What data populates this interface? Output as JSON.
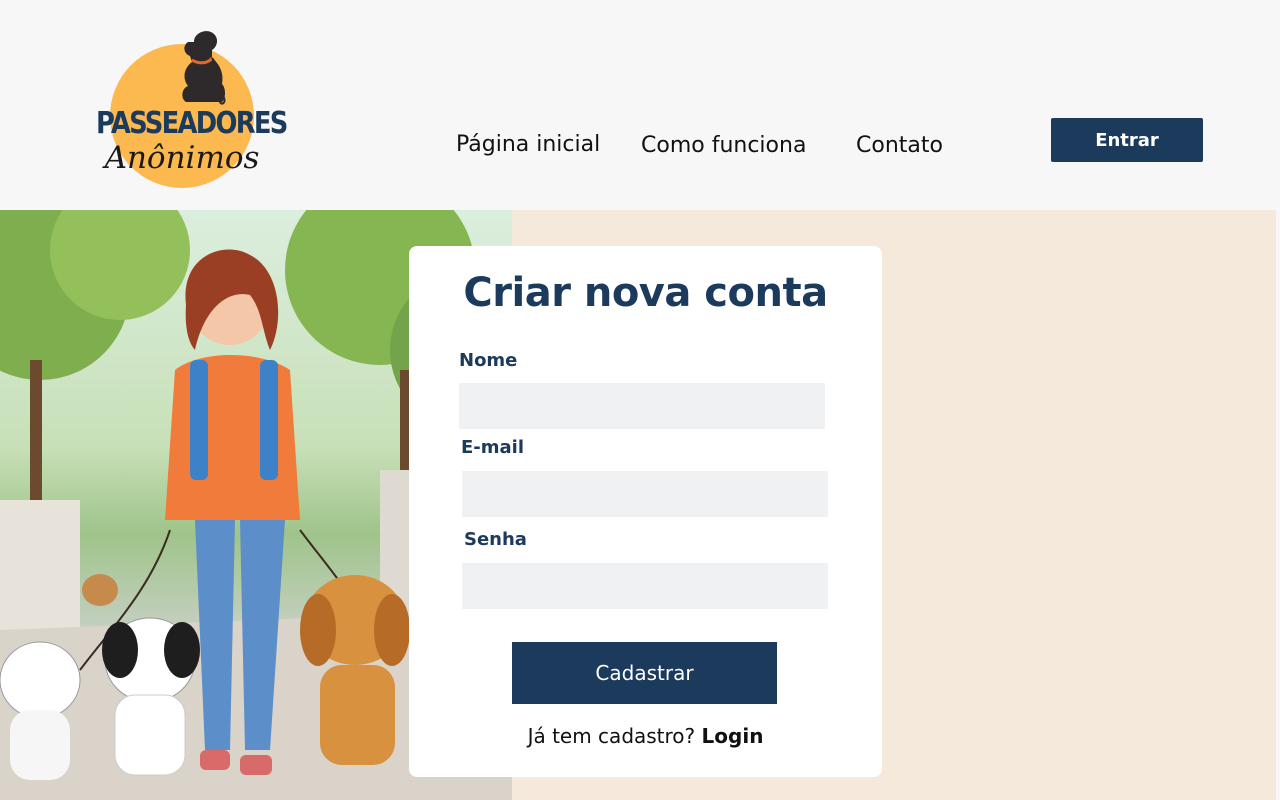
{
  "header": {
    "logo": {
      "line1": "PASSEADORES",
      "line2": "Anônimos"
    },
    "nav": [
      "Página inicial",
      "Como funciona",
      "Contato"
    ],
    "enter_button": "Entrar"
  },
  "form": {
    "title": "Criar nova conta",
    "fields": [
      {
        "label": "Nome",
        "value": "",
        "placeholder": ""
      },
      {
        "label": "E-mail",
        "value": "",
        "placeholder": ""
      },
      {
        "label": "Senha",
        "value": "",
        "placeholder": ""
      }
    ],
    "submit_label": "Cadastrar",
    "login_prompt": "Já tem cadastro?",
    "login_link": "Login"
  },
  "colors": {
    "primary": "#1b3a5c",
    "logo_circle": "#fbb94f",
    "panel_bg": "#f5e9db",
    "header_bg": "#f7f7f7",
    "input_bg": "#f0f1f3"
  }
}
